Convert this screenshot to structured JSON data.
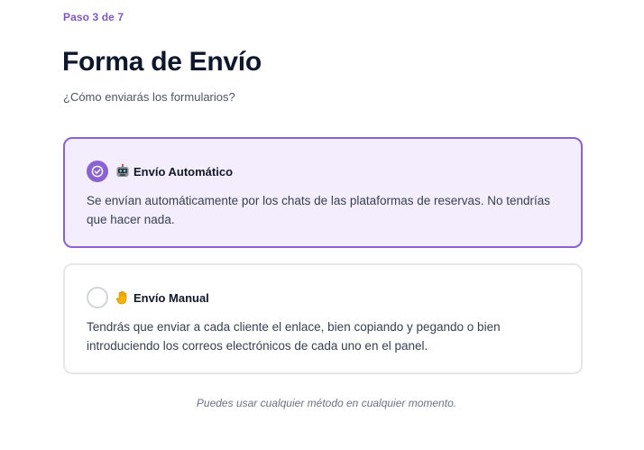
{
  "header": {
    "step": "Paso 3 de 7",
    "title": "Forma de Envío",
    "subtitle": "¿Cómo enviarás los formularios?"
  },
  "options": [
    {
      "title": "Envío Automático",
      "description": "Se envían automáticamente por los chats de las plataformas de reservas. No tendrías que hacer nada.",
      "selected": true,
      "icon": "robot-emoji-icon"
    },
    {
      "title": "Envío Manual",
      "description": "Tendrás que enviar a cada cliente el enlace, bien copiando y pegando o bien introduciendo los correos electrónicos de cada uno en el panel.",
      "selected": false,
      "icon": "raised-hand-emoji-icon"
    }
  ],
  "footer": {
    "note": "Puedes usar cualquier método en cualquier momento."
  },
  "colors": {
    "accent": "#8a63d2",
    "selected_bg": "#f3edfd",
    "step_text": "#7e57c2"
  }
}
